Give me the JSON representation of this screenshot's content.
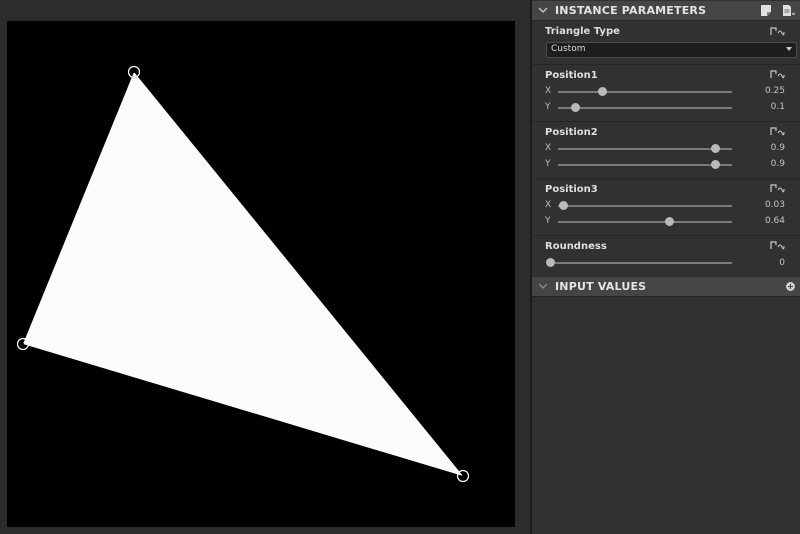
{
  "panel": {
    "instance_title": "INSTANCE PARAMETERS",
    "input_title": "INPUT VALUES",
    "triangle_type": {
      "label": "Triangle Type",
      "selected": "Custom"
    },
    "params": [
      {
        "key": "position1",
        "label": "Position1",
        "axes": [
          {
            "axis": "X",
            "value": 0.25,
            "display": "0.25"
          },
          {
            "axis": "Y",
            "value": 0.1,
            "display": "0.1"
          }
        ]
      },
      {
        "key": "position2",
        "label": "Position2",
        "axes": [
          {
            "axis": "X",
            "value": 0.9,
            "display": "0.9"
          },
          {
            "axis": "Y",
            "value": 0.9,
            "display": "0.9"
          }
        ]
      },
      {
        "key": "position3",
        "label": "Position3",
        "axes": [
          {
            "axis": "X",
            "value": 0.03,
            "display": "0.03"
          },
          {
            "axis": "Y",
            "value": 0.64,
            "display": "0.64"
          }
        ]
      }
    ],
    "roundness": {
      "label": "Roundness",
      "value": 0,
      "display": "0"
    }
  },
  "colors": {
    "canvas_bg": "#000000",
    "triangle_fill": "#fdfbfd",
    "handle_stroke": "#ffffff"
  }
}
